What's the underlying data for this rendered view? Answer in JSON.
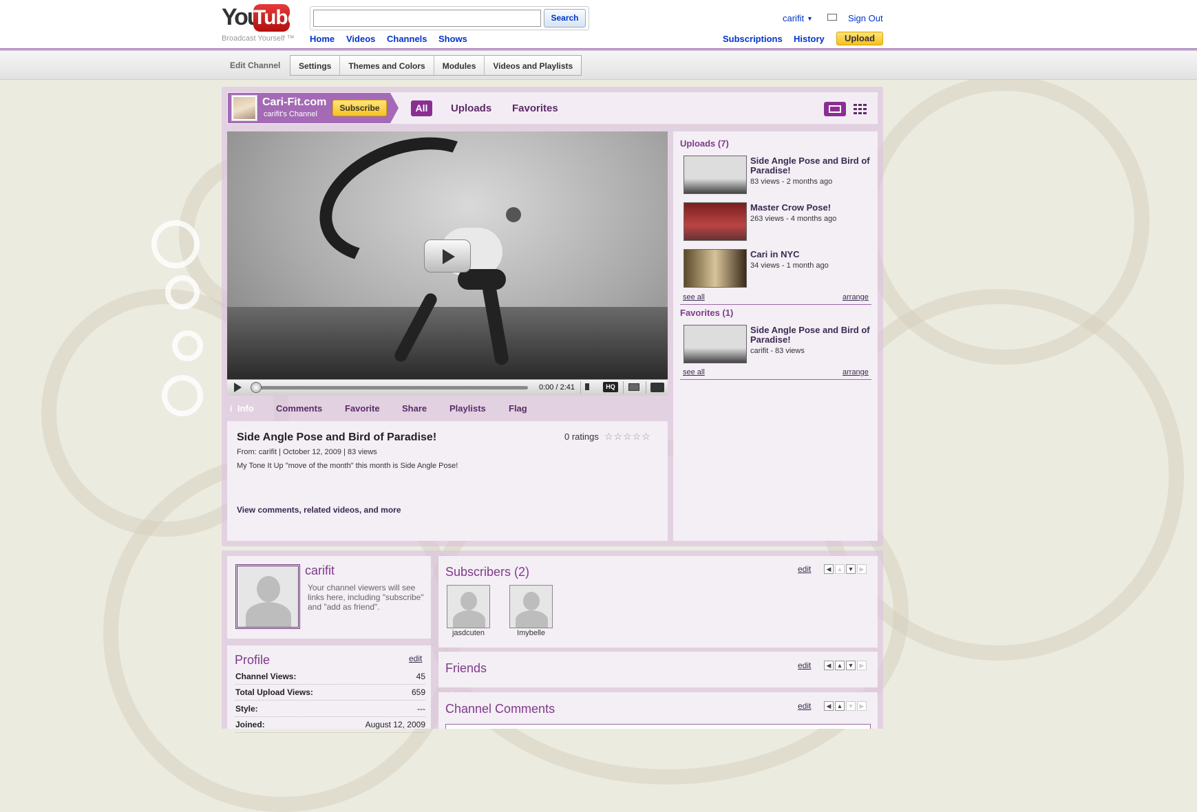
{
  "header": {
    "logo_you": "You",
    "logo_tube": "Tube",
    "tagline": "Broadcast Yourself ™",
    "search_value": "",
    "search_label": "Search",
    "nav": [
      "Home",
      "Videos",
      "Channels",
      "Shows"
    ],
    "username": "carifit",
    "sign_out": "Sign Out",
    "subscriptions": "Subscriptions",
    "history": "History",
    "upload": "Upload"
  },
  "editbar": {
    "label": "Edit Channel",
    "tabs": [
      "Settings",
      "Themes and Colors",
      "Modules",
      "Videos and Playlists"
    ]
  },
  "channel": {
    "name": "Cari-Fit.com",
    "subtitle": "carifit's Channel",
    "subscribe": "Subscribe",
    "tabs": [
      "All",
      "Uploads",
      "Favorites"
    ]
  },
  "player": {
    "time": "0:00 / 2:41",
    "hq": "HQ",
    "progress": 0
  },
  "info_tabs": [
    "Info",
    "Comments",
    "Favorite",
    "Share",
    "Playlists",
    "Flag"
  ],
  "video": {
    "title": "Side Angle Pose and Bird of Paradise!",
    "meta": "From: carifit | October 12, 2009 | 83 views",
    "description": "My Tone It Up \"move of the month\" this month is Side Angle Pose!",
    "more": "View comments, related videos, and more",
    "ratings": "0 ratings",
    "stars": "☆☆☆☆☆"
  },
  "uploads": {
    "title": "Uploads (7)",
    "items": [
      {
        "title": "Side Angle Pose and Bird of Paradise!",
        "meta": "83 views - 2 months ago"
      },
      {
        "title": "Master Crow Pose!",
        "meta": "263 views - 4 months ago"
      },
      {
        "title": "Cari in NYC",
        "meta": "34 views - 1 month ago"
      }
    ],
    "see_all": "see all",
    "arrange": "arrange"
  },
  "favorites": {
    "title": "Favorites (1)",
    "items": [
      {
        "title": "Side Angle Pose and Bird of Paradise!",
        "meta": "carifit - 83 views"
      }
    ],
    "see_all": "see all",
    "arrange": "arrange"
  },
  "profile_card": {
    "name": "carifit",
    "hint": "Your channel viewers will see links here, including \"subscribe\" and \"add as friend\"."
  },
  "profile": {
    "title": "Profile",
    "edit": "edit",
    "rows": [
      {
        "label": "Channel Views:",
        "value": "45"
      },
      {
        "label": "Total Upload Views:",
        "value": "659"
      },
      {
        "label": "Style:",
        "value": "---"
      },
      {
        "label": "Joined:",
        "value": "August 12, 2009"
      }
    ]
  },
  "subscribers": {
    "title": "Subscribers (2)",
    "edit": "edit",
    "people": [
      "jasdcuten",
      "Imybelle"
    ]
  },
  "friends": {
    "title": "Friends",
    "edit": "edit"
  },
  "comments": {
    "title": "Channel Comments",
    "edit": "edit"
  },
  "colors": {
    "accent": "#8a2f92",
    "banner": "#a46ab5",
    "link": "#0033cc",
    "upload_btn": "#f5c021"
  }
}
